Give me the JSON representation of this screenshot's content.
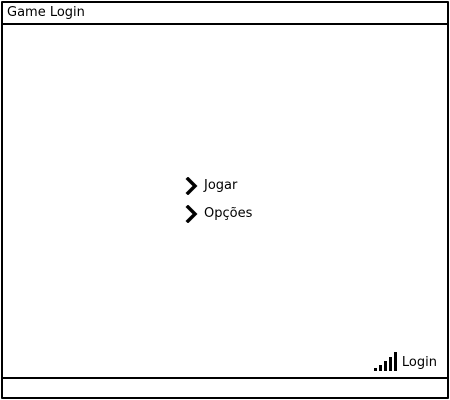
{
  "window": {
    "title": "Game Login"
  },
  "menu": {
    "items": [
      {
        "label": "Jogar",
        "icon": "chevron-right-icon"
      },
      {
        "label": "Opções",
        "icon": "chevron-right-icon"
      }
    ]
  },
  "login": {
    "label": "Login",
    "icon": "signal-bars-icon"
  }
}
